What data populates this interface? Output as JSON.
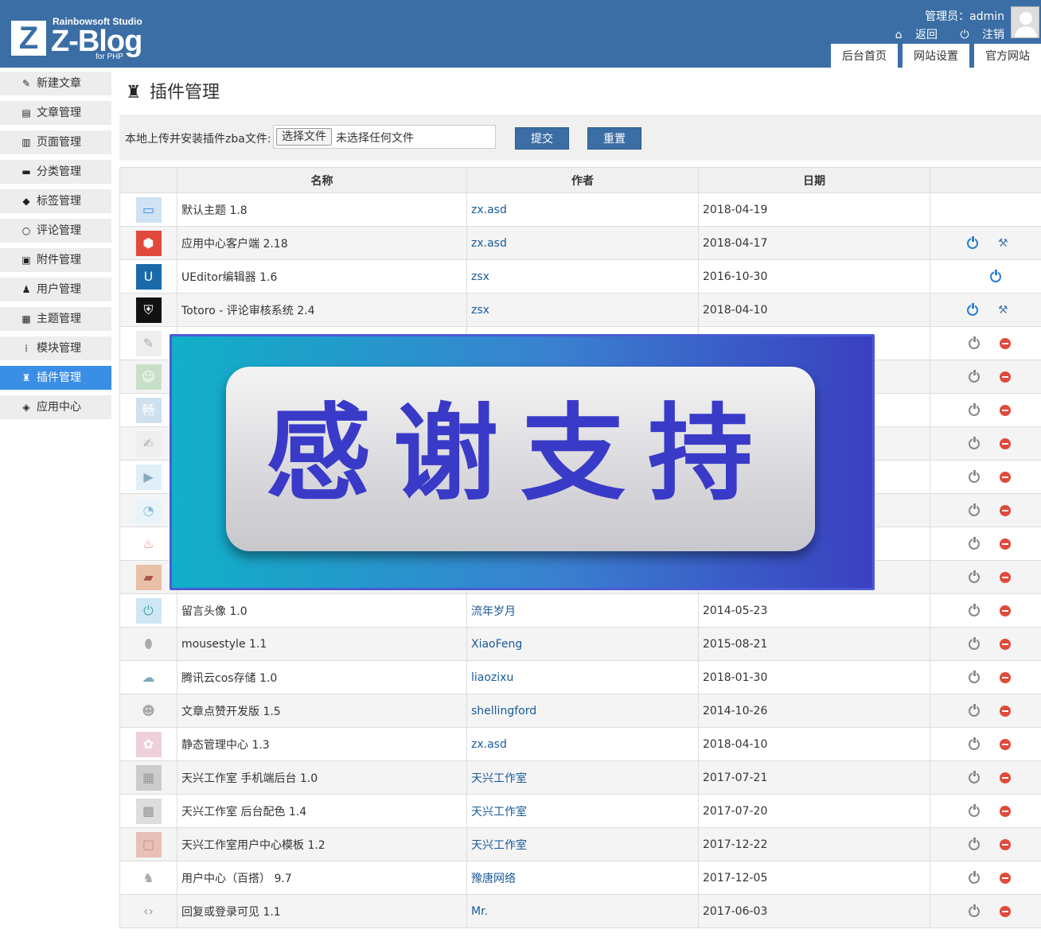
{
  "header": {
    "logo_studio": "Rainbowsoft Studio",
    "logo_name": "Z-Blog",
    "logo_sub": "for PHP",
    "logo_mark": "Z",
    "admin_label": "管理员：admin",
    "back_link": "返回",
    "logout_link": "注销",
    "tabs": [
      {
        "label": "后台首页"
      },
      {
        "label": "网站设置"
      },
      {
        "label": "官方网站"
      }
    ]
  },
  "sidebar": {
    "items": [
      {
        "label": "新建文章",
        "icon": "edit-icon"
      },
      {
        "label": "文章管理",
        "icon": "file-icon"
      },
      {
        "label": "页面管理",
        "icon": "page-icon"
      },
      {
        "label": "分类管理",
        "icon": "folder-icon"
      },
      {
        "label": "标签管理",
        "icon": "tag-icon"
      },
      {
        "label": "评论管理",
        "icon": "comment-icon"
      },
      {
        "label": "附件管理",
        "icon": "attachment-icon"
      },
      {
        "label": "用户管理",
        "icon": "user-icon"
      },
      {
        "label": "主题管理",
        "icon": "theme-icon"
      },
      {
        "label": "模块管理",
        "icon": "module-icon"
      },
      {
        "label": "插件管理",
        "icon": "plugin-icon"
      },
      {
        "label": "应用中心",
        "icon": "app-center-icon"
      }
    ]
  },
  "page": {
    "title": "插件管理",
    "upload_label": "本地上传并安装插件zba文件:",
    "file_button": "选择文件",
    "file_status": "未选择任何文件",
    "submit_label": "提交",
    "reset_label": "重置"
  },
  "table": {
    "headers": [
      "",
      "名称",
      "作者",
      "日期",
      ""
    ],
    "rows": [
      {
        "name": "默认主题 1.8",
        "author": "zx.asd",
        "date": "2018-04-19"
      },
      {
        "name": "应用中心客户端 2.18",
        "author": "zx.asd",
        "date": "2018-04-17"
      },
      {
        "name": "UEditor编辑器 1.6",
        "author": "zsx",
        "date": "2016-10-30"
      },
      {
        "name": "Totoro - 评论审核系统 2.4",
        "author": "zsx",
        "date": "2018-04-10"
      },
      {
        "name": "",
        "author": "",
        "date": ""
      },
      {
        "name": "",
        "author": "",
        "date": ""
      },
      {
        "name": "",
        "author": "",
        "date": ""
      },
      {
        "name": "",
        "author": "",
        "date": ""
      },
      {
        "name": "",
        "author": "",
        "date": ""
      },
      {
        "name": "",
        "author": "",
        "date": ""
      },
      {
        "name": "",
        "author": "",
        "date": ""
      },
      {
        "name": "",
        "author": "",
        "date": ""
      },
      {
        "name": "留言头像 1.0",
        "author": "流年岁月",
        "date": "2014-05-23"
      },
      {
        "name": "mousestyle 1.1",
        "author": "XiaoFeng",
        "date": "2015-08-21"
      },
      {
        "name": "腾讯云cos存储 1.0",
        "author": "liaozixu",
        "date": "2018-01-30"
      },
      {
        "name": "文章点赞开发版 1.5",
        "author": "shellingford",
        "date": "2014-10-26"
      },
      {
        "name": "静态管理中心 1.3",
        "author": "zx.asd",
        "date": "2018-04-10"
      },
      {
        "name": "天兴工作室 手机端后台 1.0",
        "author": "天兴工作室",
        "date": "2017-07-21"
      },
      {
        "name": "天兴工作室 后台配色 1.4",
        "author": "天兴工作室",
        "date": "2017-07-20"
      },
      {
        "name": "天兴工作室用户中心模板 1.2",
        "author": "天兴工作室",
        "date": "2017-12-22"
      },
      {
        "name": "用户中心（百搭） 9.7",
        "author": "豫唐网络",
        "date": "2017-12-05"
      },
      {
        "name": "回复或登录可见 1.1",
        "author": "Mr.",
        "date": "2017-06-03"
      }
    ]
  },
  "banner": {
    "text": "感谢支持"
  },
  "colors": {
    "header_bg": "#3a6ea5",
    "active_item": "#3a8ee6",
    "link": "#1a5a9a"
  }
}
